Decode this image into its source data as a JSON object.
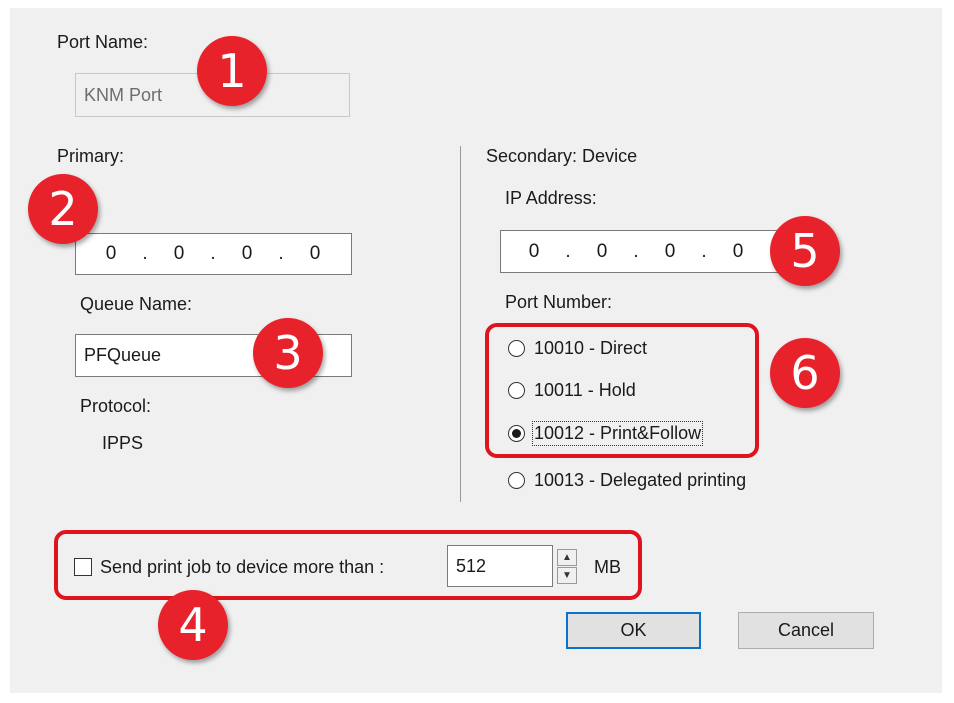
{
  "port": {
    "name_label": "Port Name:",
    "name_value": "KNM Port"
  },
  "primary": {
    "heading": "Primary:",
    "ip": [
      "0",
      "0",
      "0",
      "0"
    ],
    "queue_label": "Queue Name:",
    "queue_value": "PFQueue",
    "protocol_label": "Protocol:",
    "protocol_value": "IPPS"
  },
  "secondary": {
    "heading": "Secondary: Device",
    "ip_label": "IP Address:",
    "ip": [
      "0",
      "0",
      "0",
      "0"
    ],
    "port_label": "Port Number:",
    "options": [
      {
        "label": "10010 - Direct",
        "checked": false
      },
      {
        "label": "10011 - Hold",
        "checked": false
      },
      {
        "label": "10012 - Print&Follow",
        "checked": true
      },
      {
        "label": "10013 - Delegated printing",
        "checked": false
      }
    ]
  },
  "send": {
    "label": "Send print job to device more than :",
    "value": "512",
    "unit": "MB",
    "checked": false
  },
  "buttons": {
    "ok": "OK",
    "cancel": "Cancel"
  },
  "callouts": [
    "1",
    "2",
    "3",
    "4",
    "5",
    "6"
  ],
  "colors": {
    "callout": "#e8222b",
    "highlight_box": "#e0141e",
    "default_button_border": "#0a72c8"
  }
}
